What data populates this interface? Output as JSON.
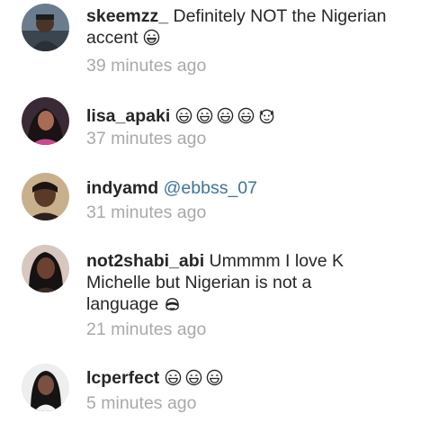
{
  "comments": [
    {
      "username": "skeemzz_",
      "text": "Definitely NOT the Nigerian accent",
      "emoji": [
        "grinning-face-icon"
      ],
      "time": "39 minutes ago"
    },
    {
      "username": "lisa_apaki",
      "text": "",
      "emoji": [
        "grinning-face-icon",
        "grinning-face-icon",
        "grinning-face-icon",
        "grinning-face-icon",
        "face-with-hands-icon"
      ],
      "time": "37 minutes ago"
    },
    {
      "username": "indyamd",
      "mention": "@ebbss_07",
      "time": "31 minutes ago"
    },
    {
      "username": "not2shabi_abi",
      "text_line1": "Ummmm I love K",
      "text_line2": "Michelle but Nigerian is not a",
      "text_line3": "language",
      "emoji": [
        "see-no-evil-monkey-icon"
      ],
      "time": "21 minutes ago"
    },
    {
      "username": "lcperfect",
      "text": "",
      "emoji": [
        "grinning-face-icon",
        "grinning-face-icon",
        "grinning-face-icon"
      ],
      "time": "5 minutes ago"
    }
  ],
  "colors": {
    "text": "#262626",
    "timestamp": "#a9a9a9",
    "mention": "#3f729b"
  }
}
